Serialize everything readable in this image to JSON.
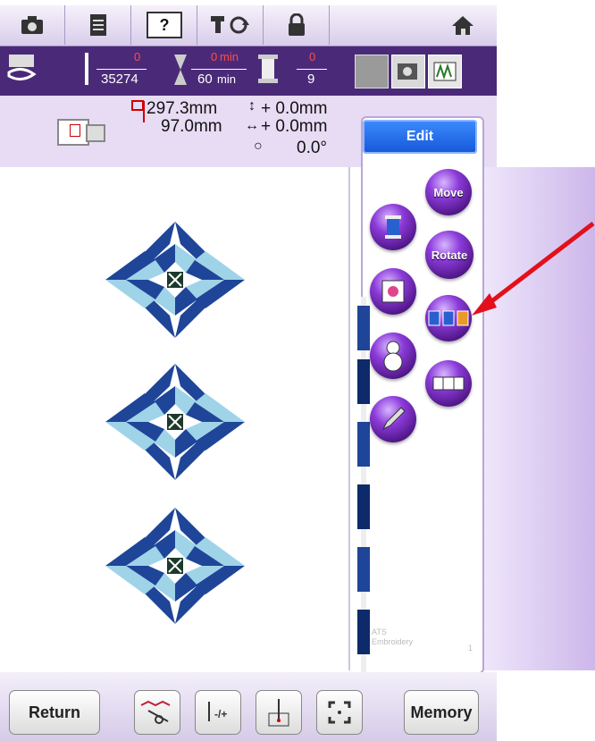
{
  "top_toolbar": {
    "icons": [
      "camera-icon",
      "document-icon",
      "help-icon",
      "machine-reset-icon",
      "lock-icon",
      "home-icon"
    ],
    "help_label": "?"
  },
  "status": {
    "stitch_counter": "0",
    "stitch_total": "35274",
    "time_current": "0",
    "time_current_unit": "min",
    "time_total": "60",
    "time_total_unit": "min",
    "color_counter": "0",
    "color_total": "9"
  },
  "info": {
    "height": "297.3mm",
    "width": "97.0mm",
    "offset_vertical": "+    0.0mm",
    "offset_horizontal": "+    0.0mm",
    "rotation": "0.0°"
  },
  "edit_panel": {
    "title": "Edit",
    "move_label": "Move",
    "rotate_label": "Rotate"
  },
  "ghost": {
    "line1": "ATS",
    "line2": "Embroidery",
    "num": "1"
  },
  "bottom": {
    "return_label": "Return",
    "memory_label": "Memory"
  },
  "colors": {
    "dark_blue": "#1f4598",
    "light_blue": "#9fd3e8",
    "purple_dark": "#4a2a78",
    "accent_red": "#e3101b"
  }
}
